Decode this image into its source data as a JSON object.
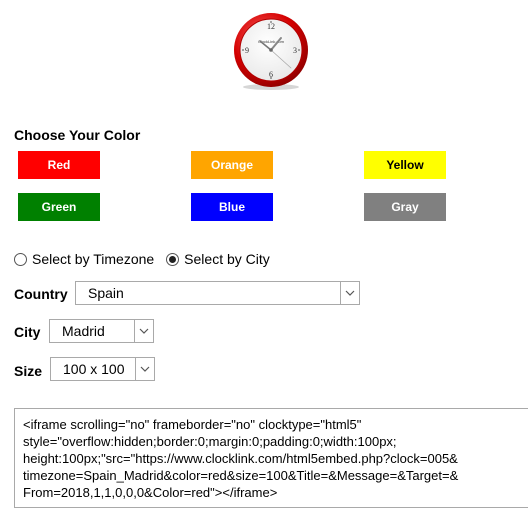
{
  "clock": {
    "brand": "ClockLink.com",
    "numerals": {
      "n12": "12",
      "n3": "3",
      "n6": "6",
      "n9": "9"
    }
  },
  "color_section": {
    "title": "Choose Your Color",
    "buttons": [
      {
        "label": "Red",
        "color": "#ff0000",
        "text_color": "#ffffff"
      },
      {
        "label": "Orange",
        "color": "#ffa500",
        "text_color": "#ffffff"
      },
      {
        "label": "Yellow",
        "color": "#ffff00",
        "text_color": "#000000"
      },
      {
        "label": "Green",
        "color": "#008000",
        "text_color": "#ffffff"
      },
      {
        "label": "Blue",
        "color": "#0000ff",
        "text_color": "#ffffff"
      },
      {
        "label": "Gray",
        "color": "#808080",
        "text_color": "#ffffff"
      }
    ]
  },
  "select_mode": {
    "options": [
      {
        "label": "Select by Timezone",
        "selected": false
      },
      {
        "label": "Select by City",
        "selected": true
      }
    ]
  },
  "country": {
    "label": "Country",
    "value": "Spain"
  },
  "city": {
    "label": "City",
    "value": "Madrid"
  },
  "size": {
    "label": "Size",
    "value": "100 x 100"
  },
  "embed_code": "<iframe scrolling=\"no\" frameborder=\"no\" clocktype=\"html5\"\nstyle=\"overflow:hidden;border:0;margin:0;padding:0;width:100px;\nheight:100px;\"src=\"https://www.clocklink.com/html5embed.php?clock=005&\ntimezone=Spain_Madrid&color=red&size=100&Title=&Message=&Target=&\nFrom=2018,1,1,0,0,0&Color=red\"></iframe>"
}
